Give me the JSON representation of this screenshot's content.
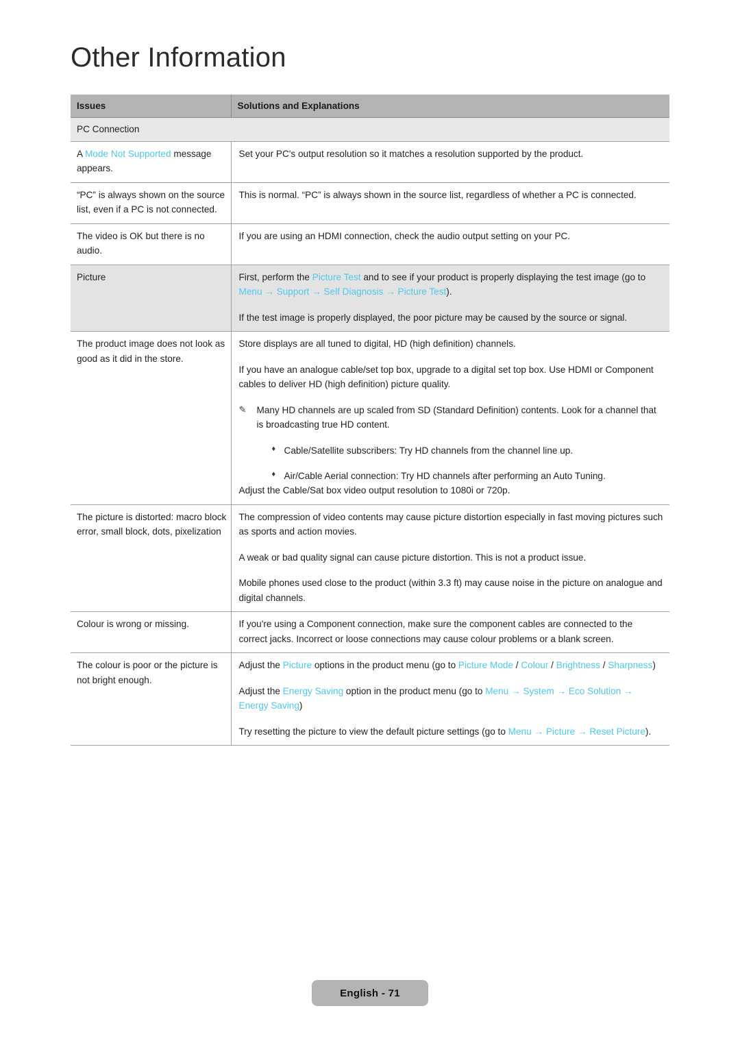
{
  "page": {
    "title": "Other Information",
    "footer_label": "English - 71",
    "accent_color": "#4fc8ee",
    "header_bg": "#b3b3b3",
    "section_bg": "#e7e7e7",
    "shaded_row_bg": "#e3e3e3"
  },
  "table": {
    "headers": {
      "issues": "Issues",
      "solutions": "Solutions and Explanations"
    },
    "section_label": "PC Connection",
    "rows": [
      {
        "issue_plain": "A ",
        "issue_accent": "Mode Not Supported",
        "issue_tail": " message appears.",
        "solution": "Set your PC's output resolution so it matches a resolution supported by the product."
      },
      {
        "issue": "“PC” is always shown on the source list, even if a PC is not connected.",
        "solution": "This is normal. “PC” is always shown in the source list, regardless of whether a PC is connected."
      },
      {
        "issue": "The video is OK but there is no audio.",
        "solution": "If you are using an HDMI connection, check the audio output setting on your PC."
      },
      {
        "issue": "Picture",
        "sol_p1_a": "First, perform the ",
        "sol_p1_accent1": "Picture Test",
        "sol_p1_b": " and to see if your product is properly displaying the test image (go to ",
        "sol_p1_menu": "Menu",
        "sol_p1_arrow1": "→",
        "sol_p1_support": "Support",
        "sol_p1_arrow2": "→",
        "sol_p1_selfdiag": "Self Diagnosis",
        "sol_p1_arrow3": "→",
        "sol_p1_picturetest": "Picture Test",
        "sol_p1_close": ").",
        "sol_p2": "If the test image is properly displayed, the poor picture may be caused by the source or signal."
      },
      {
        "issue": "The product image does not look as good as it did in the store.",
        "sol_p1": "Store displays are all tuned to digital, HD (high definition) channels.",
        "sol_p2": "If you have an analogue cable/set top box, upgrade to a digital set top box. Use HDMI or Component cables to deliver HD (high definition) picture quality.",
        "note_icon": "pencil-note-icon",
        "note_glyph": "✎",
        "sol_note": "Many HD channels are up scaled from SD (Standard Definition) contents. Look for a channel that is broadcasting true HD content.",
        "bullet_glyph": "♦",
        "sol_bullet1": "Cable/Satellite subscribers: Try HD channels from the channel line up.",
        "sol_bullet2": "Air/Cable Aerial connection: Try HD channels after performing an Auto Tuning.",
        "sol_p3": "Adjust the Cable/Sat box video output resolution to 1080i or 720p."
      },
      {
        "issue": "The picture is distorted: macro block error, small block, dots, pixelization",
        "sol_p1": "The compression of video contents may cause picture distortion especially in fast moving pictures such as sports and action movies.",
        "sol_p2": "A weak or bad quality signal can cause picture distortion. This is not a product issue.",
        "sol_p3": "Mobile phones used close to the product (within 3.3 ft) may cause noise in the picture on analogue and digital channels."
      },
      {
        "issue": "Colour is wrong or missing.",
        "solution": "If you're using a Component connection, make sure the component cables are connected to the correct jacks. Incorrect or loose connections may cause colour problems or a blank screen."
      },
      {
        "issue": "The colour is poor or the picture is not bright enough.",
        "sol_p1_a": "Adjust the ",
        "sol_p1_picture": "Picture",
        "sol_p1_b": " options in the product menu (go to ",
        "sol_p1_picturemode": "Picture Mode",
        "sol_p1_sep1": "/",
        "sol_p1_colour": "Colour",
        "sol_p1_sep2": "/",
        "sol_p1_brightness": "Brightness",
        "sol_p1_sep3": "/",
        "sol_p1_sharpness": "Sharpness",
        "sol_p1_close": ")",
        "sol_p2_a": "Adjust the ",
        "sol_p2_energy": "Energy Saving",
        "sol_p2_b": " option in the product menu (go to ",
        "sol_p2_menu": "Menu",
        "sol_p2_arrow1": "→",
        "sol_p2_system": "System",
        "sol_p2_arrow2": "→",
        "sol_p2_eco": "Eco Solution",
        "sol_p2_arrow3": "→",
        "sol_p2_energy2": "Energy Saving",
        "sol_p2_close": ")",
        "sol_p3_a": "Try resetting the picture to view the default picture settings (go to ",
        "sol_p3_menu": "Menu",
        "sol_p3_arrow1": "→",
        "sol_p3_picture": "Picture",
        "sol_p3_arrow2": "→",
        "sol_p3_reset": "Reset Picture",
        "sol_p3_close": ")."
      }
    ]
  }
}
